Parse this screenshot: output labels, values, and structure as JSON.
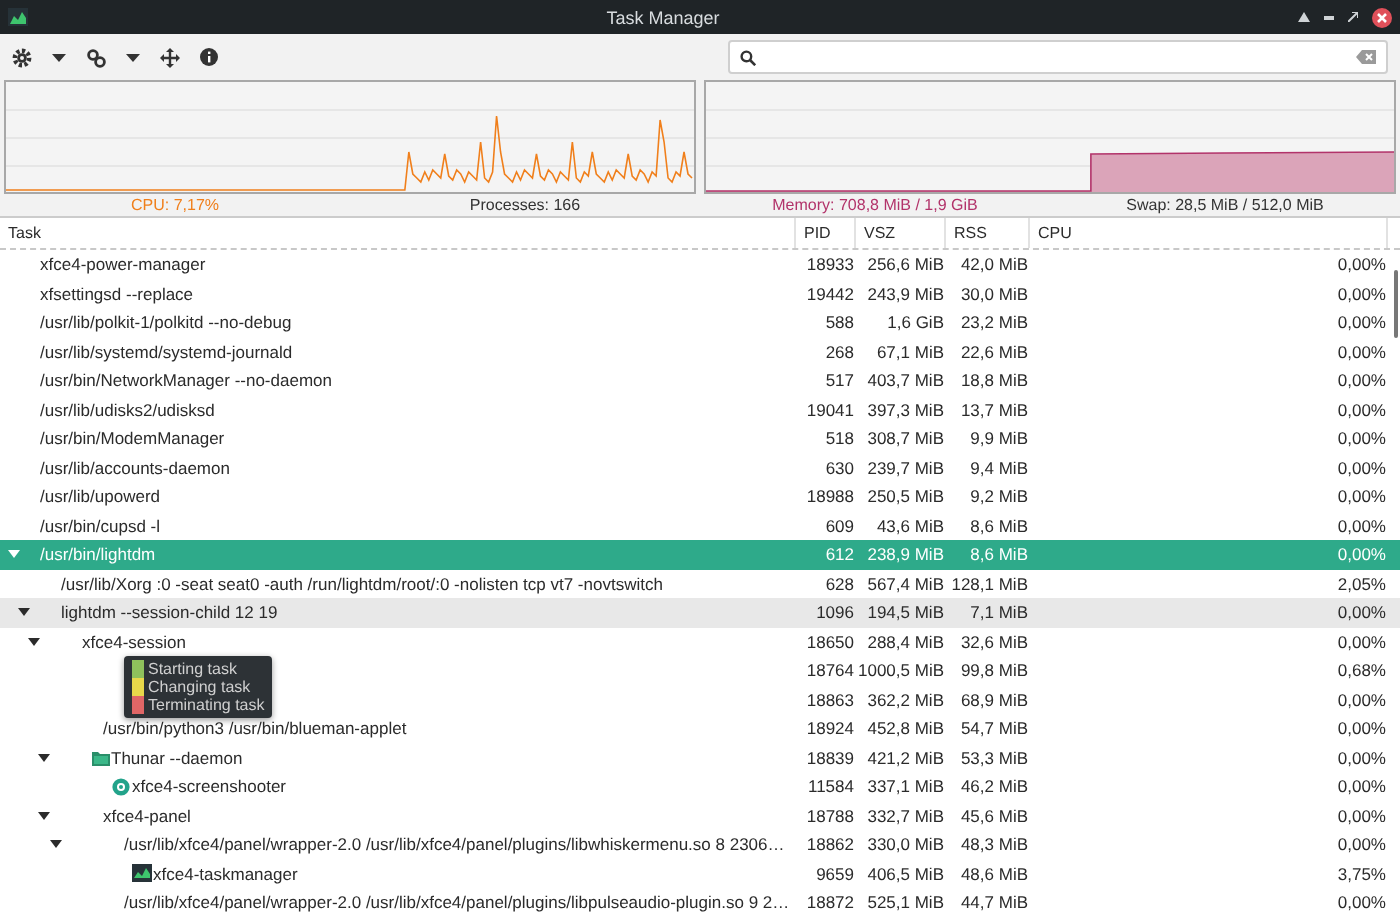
{
  "window": {
    "title": "Task Manager"
  },
  "summary": {
    "cpu": "CPU: 7,17%",
    "processes": "Processes: 166",
    "memory": "Memory: 708,8 MiB / 1,9 GiB",
    "swap": "Swap: 28,5 MiB / 512,0 MiB"
  },
  "columns": [
    "Task",
    "PID",
    "VSZ",
    "RSS",
    "CPU"
  ],
  "processes": [
    {
      "task": "xfce4-power-manager",
      "pid": "18933",
      "vsz": "256,6 MiB",
      "rss": "42,0 MiB",
      "cpu": "0,00%",
      "selected": false,
      "hovered": false,
      "kind": "plain"
    },
    {
      "task": "xfsettingsd --replace",
      "pid": "19442",
      "vsz": "243,9 MiB",
      "rss": "30,0 MiB",
      "cpu": "0,00%",
      "selected": false,
      "hovered": false,
      "kind": "plain"
    },
    {
      "task": "/usr/lib/polkit-1/polkitd --no-debug",
      "pid": "588",
      "vsz": "1,6 GiB",
      "rss": "23,2 MiB",
      "cpu": "0,00%",
      "selected": false,
      "hovered": false,
      "kind": "plain"
    },
    {
      "task": "/usr/lib/systemd/systemd-journald",
      "pid": "268",
      "vsz": "67,1 MiB",
      "rss": "22,6 MiB",
      "cpu": "0,00%",
      "selected": false,
      "hovered": false,
      "kind": "plain"
    },
    {
      "task": "/usr/bin/NetworkManager --no-daemon",
      "pid": "517",
      "vsz": "403,7 MiB",
      "rss": "18,8 MiB",
      "cpu": "0,00%",
      "selected": false,
      "hovered": false,
      "kind": "plain"
    },
    {
      "task": "/usr/lib/udisks2/udisksd",
      "pid": "19041",
      "vsz": "397,3 MiB",
      "rss": "13,7 MiB",
      "cpu": "0,00%",
      "selected": false,
      "hovered": false,
      "kind": "plain"
    },
    {
      "task": "/usr/bin/ModemManager",
      "pid": "518",
      "vsz": "308,7 MiB",
      "rss": "9,9 MiB",
      "cpu": "0,00%",
      "selected": false,
      "hovered": false,
      "kind": "plain"
    },
    {
      "task": "/usr/lib/accounts-daemon",
      "pid": "630",
      "vsz": "239,7 MiB",
      "rss": "9,4 MiB",
      "cpu": "0,00%",
      "selected": false,
      "hovered": false,
      "kind": "plain"
    },
    {
      "task": "/usr/lib/upowerd",
      "pid": "18988",
      "vsz": "250,5 MiB",
      "rss": "9,2 MiB",
      "cpu": "0,00%",
      "selected": false,
      "hovered": false,
      "kind": "plain"
    },
    {
      "task": "/usr/bin/cupsd -l",
      "pid": "609",
      "vsz": "43,6 MiB",
      "rss": "8,6 MiB",
      "cpu": "0,00%",
      "selected": false,
      "hovered": false,
      "kind": "plain"
    },
    {
      "task": "/usr/bin/lightdm",
      "pid": "612",
      "vsz": "238,9 MiB",
      "rss": "8,6 MiB",
      "cpu": "0,00%",
      "selected": true,
      "hovered": false,
      "kind": "plain",
      "expanded": true,
      "children": [
        {
          "task": "/usr/lib/Xorg :0 -seat seat0 -auth /run/lightdm/root/:0 -nolisten tcp vt7 -novtswitch",
          "pid": "628",
          "vsz": "567,4 MiB",
          "rss": "128,1 MiB",
          "cpu": "2,05%",
          "selected": false,
          "hovered": false,
          "kind": "plain"
        },
        {
          "task": "lightdm --session-child 12 19",
          "pid": "1096",
          "vsz": "194,5 MiB",
          "rss": "7,1 MiB",
          "cpu": "0,00%",
          "selected": false,
          "hovered": true,
          "kind": "plain",
          "expanded": true,
          "children": [
            {
              "task": "xfce4-session",
              "pid": "18650",
              "vsz": "288,4 MiB",
              "rss": "32,6 MiB",
              "cpu": "0,00%",
              "selected": false,
              "hovered": false,
              "kind": "plain",
              "expanded": true,
              "children": [
                {
                  "pid": "18764",
                  "vsz": "1000,5 MiB",
                  "rss": "99,8 MiB",
                  "cpu": "0,68%",
                  "selected": false,
                  "hovered": false,
                  "kind": "plain"
                },
                {
                  "pid": "18863",
                  "vsz": "362,2 MiB",
                  "rss": "68,9 MiB",
                  "cpu": "0,00%",
                  "selected": false,
                  "hovered": false,
                  "kind": "plain"
                },
                {
                  "task": "/usr/bin/python3 /usr/bin/blueman-applet",
                  "pid": "18924",
                  "vsz": "452,8 MiB",
                  "rss": "54,7 MiB",
                  "cpu": "0,00%",
                  "selected": false,
                  "hovered": false,
                  "kind": "plain"
                },
                {
                  "task": "Thunar --daemon",
                  "pid": "18839",
                  "vsz": "421,2 MiB",
                  "rss": "53,3 MiB",
                  "cpu": "0,00%",
                  "selected": false,
                  "hovered": false,
                  "kind": "folder",
                  "expanded": true,
                  "children": [
                    {
                      "task": "xfce4-screenshooter",
                      "pid": "11584",
                      "vsz": "337,1 MiB",
                      "rss": "46,2 MiB",
                      "cpu": "0,00%",
                      "selected": false,
                      "hovered": false,
                      "kind": "camera"
                    }
                  ]
                },
                {
                  "task": "xfce4-panel",
                  "pid": "18788",
                  "vsz": "332,7 MiB",
                  "rss": "45,6 MiB",
                  "cpu": "0,00%",
                  "selected": false,
                  "hovered": false,
                  "kind": "plain",
                  "expanded": true,
                  "children": [
                    {
                      "task": "/usr/lib/xfce4/panel/wrapper-2.0 /usr/lib/xfce4/panel/plugins/libwhiskermenu.so 8 2306…",
                      "pid": "18862",
                      "vsz": "330,0 MiB",
                      "rss": "48,3 MiB",
                      "cpu": "0,00%",
                      "selected": false,
                      "hovered": false,
                      "kind": "plain",
                      "expanded": true,
                      "children": [
                        {
                          "task": "xfce4-taskmanager",
                          "pid": "9659",
                          "vsz": "406,5 MiB",
                          "rss": "48,6 MiB",
                          "cpu": "3,75%",
                          "selected": false,
                          "hovered": false,
                          "kind": "monitor"
                        }
                      ]
                    },
                    {
                      "task": "/usr/lib/xfce4/panel/wrapper-2.0 /usr/lib/xfce4/panel/plugins/libpulseaudio-plugin.so 9 2…",
                      "pid": "18872",
                      "vsz": "525,1 MiB",
                      "rss": "44,7 MiB",
                      "cpu": "0,00%",
                      "selected": false,
                      "hovered": false,
                      "kind": "plain"
                    }
                  ]
                }
              ]
            }
          ]
        }
      ]
    }
  ],
  "tooltip": {
    "items": [
      {
        "label": "Starting task",
        "color": "#8fc15c"
      },
      {
        "label": "Changing task",
        "color": "#e8d84a"
      },
      {
        "label": "Terminating task",
        "color": "#e06666"
      }
    ]
  }
}
